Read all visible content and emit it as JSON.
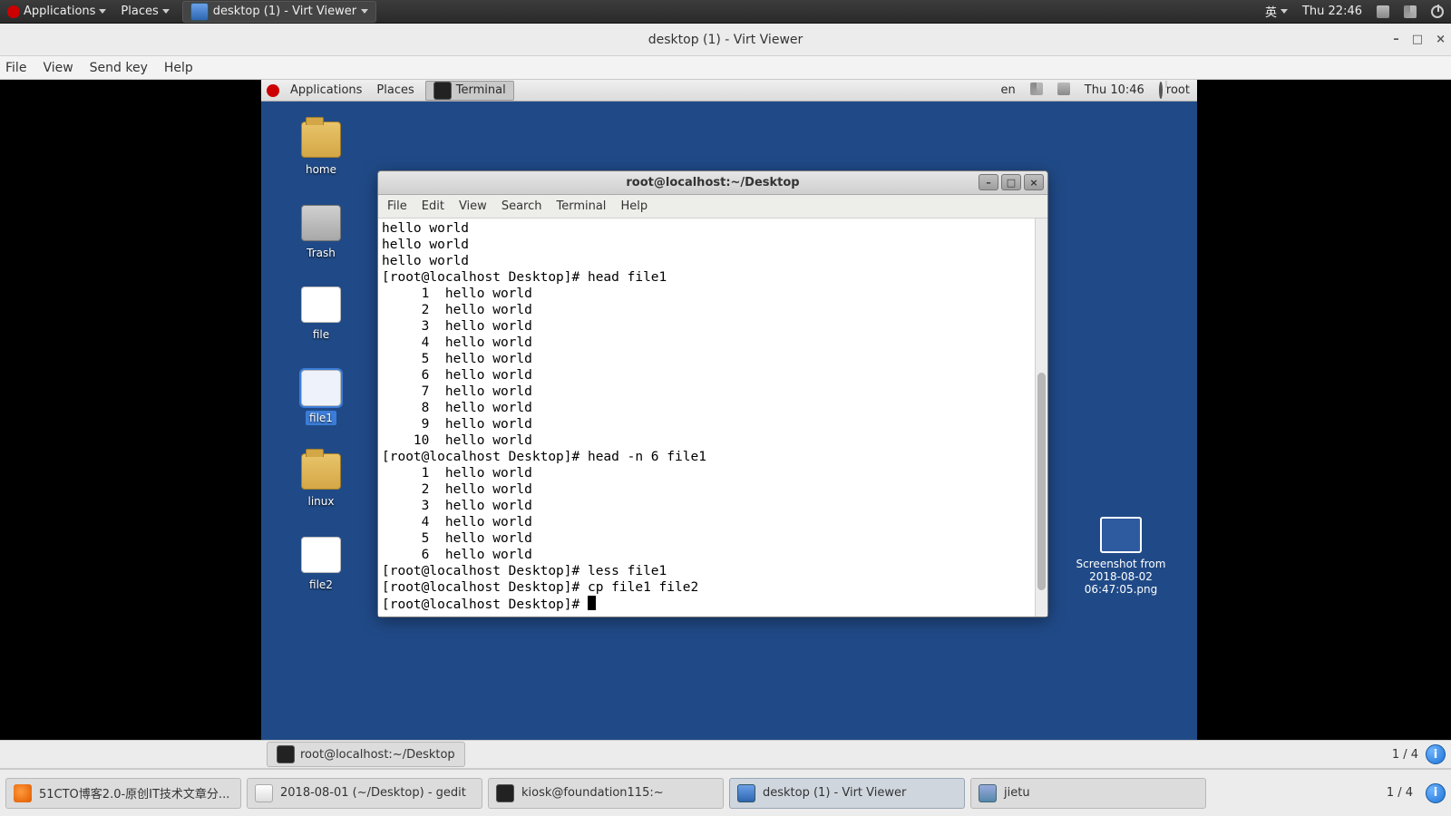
{
  "host_panel": {
    "applications": "Applications",
    "places": "Places",
    "task_title": "desktop (1) - Virt Viewer",
    "input_lang": "英",
    "clock": "Thu 22:46"
  },
  "virt_viewer": {
    "title": "desktop (1) - Virt Viewer",
    "win_min": "–",
    "win_max": "□",
    "win_close": "×",
    "menu": {
      "file": "File",
      "view": "View",
      "sendkey": "Send key",
      "help": "Help"
    }
  },
  "guest_panel": {
    "applications": "Applications",
    "places": "Places",
    "terminal_task": "Terminal",
    "lang": "en",
    "clock": "Thu 10:46",
    "user": "root"
  },
  "desktop_icons": {
    "home": "home",
    "trash": "Trash",
    "file": "file",
    "file1": "file1",
    "linux": "linux",
    "file2": "file2",
    "screenshot_l1": "Screenshot from",
    "screenshot_l2": "2018-08-02",
    "screenshot_l3": "06:47:05.png"
  },
  "terminal": {
    "title": "root@localhost:~/Desktop",
    "menu": {
      "file": "File",
      "edit": "Edit",
      "view": "View",
      "search": "Search",
      "terminal": "Terminal",
      "help": "Help"
    },
    "btn_min": "–",
    "btn_max": "□",
    "btn_close": "×",
    "lines": [
      "hello world",
      "hello world",
      "hello world",
      "[root@localhost Desktop]# head file1",
      "     1  hello world",
      "     2  hello world",
      "     3  hello world",
      "     4  hello world",
      "     5  hello world",
      "     6  hello world",
      "     7  hello world",
      "     8  hello world",
      "     9  hello world",
      "    10  hello world",
      "[root@localhost Desktop]# head -n 6 file1",
      "     1  hello world",
      "     2  hello world",
      "     3  hello world",
      "     4  hello world",
      "     5  hello world",
      "     6  hello world",
      "[root@localhost Desktop]# less file1",
      "[root@localhost Desktop]# cp file1 file2",
      "[root@localhost Desktop]# "
    ]
  },
  "mid_bar": {
    "task": "root@localhost:~/Desktop",
    "ws": "1 / 4"
  },
  "host_taskbar": {
    "t1": "51CTO博客2.0-原创IT技术文章分...",
    "t2": "2018-08-01 (~/Desktop) - gedit",
    "t3": "kiosk@foundation115:~",
    "t4": "desktop (1) - Virt Viewer",
    "t5": "jietu",
    "ws": "1 / 4"
  }
}
